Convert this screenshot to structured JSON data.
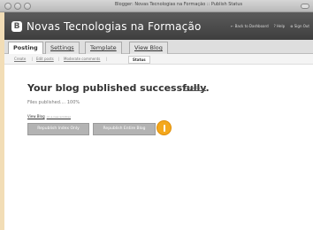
{
  "window": {
    "title": "Blogger: Novas Tecnologias na Formação :: Publish Status"
  },
  "header": {
    "logo_letter": "B",
    "blog_title": "Novas Tecnologias na Formação",
    "links": [
      "← Back to Dashboard",
      "? Help",
      "⊗ Sign Out"
    ]
  },
  "tabs": [
    {
      "label": "Posting",
      "active": true
    },
    {
      "label": "Settings",
      "active": false
    },
    {
      "label": "Template",
      "active": false
    },
    {
      "label": "View Blog",
      "active": false
    }
  ],
  "subtabs": [
    {
      "label": "Create",
      "active": false
    },
    {
      "label": "Edit posts",
      "active": false
    },
    {
      "label": "Moderate comments",
      "active": false
    },
    {
      "label": "Status",
      "active": true
    }
  ],
  "main": {
    "headline": "Your blog published successfully.",
    "details_link": "(Details...)",
    "files_status": "Files published.... 100%",
    "view_blog": "View Blog",
    "view_blog_hint": "(in a new window)",
    "republish_index_label": "Republish Index Only",
    "republish_entire_label": "Republish Entire Blog"
  },
  "colors": {
    "marker": "#f4a81d",
    "header_bg": "#4d4d4d",
    "button_bg": "#b3b3b3"
  }
}
